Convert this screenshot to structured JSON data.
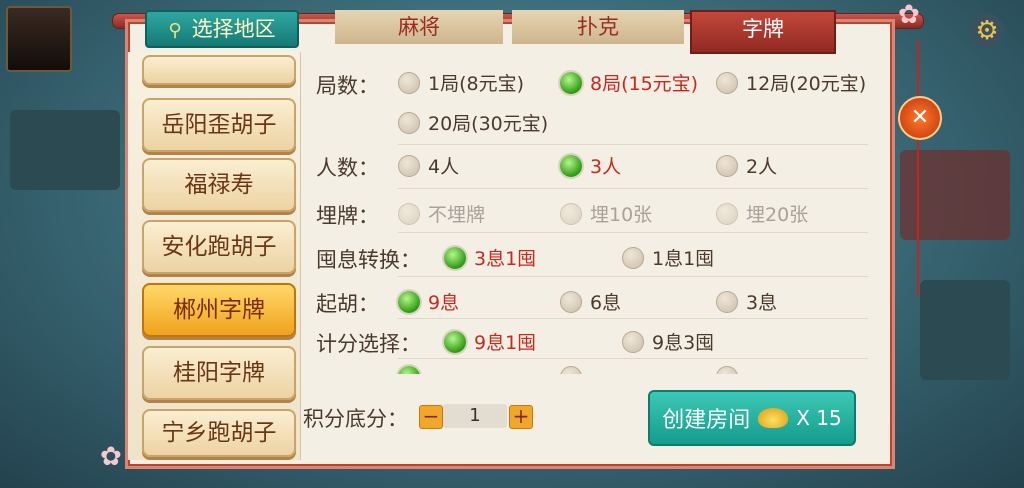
{
  "tabs": {
    "region": "选择地区",
    "mahjong": "麻将",
    "poker": "扑克",
    "zipai": "字牌"
  },
  "regions": [
    {
      "label": "岳阳歪胡子",
      "active": false
    },
    {
      "label": "福禄寿",
      "active": false
    },
    {
      "label": "安化跑胡子",
      "active": false
    },
    {
      "label": "郴州字牌",
      "active": true
    },
    {
      "label": "桂阳字牌",
      "active": false
    },
    {
      "label": "宁乡跑胡子",
      "active": false
    }
  ],
  "options": {
    "rounds": {
      "label": "局数：",
      "choices": [
        "1局(8元宝)",
        "8局(15元宝)",
        "12局(20元宝)",
        "20局(30元宝)"
      ],
      "selected": 1
    },
    "players": {
      "label": "人数：",
      "choices": [
        "4人",
        "3人",
        "2人"
      ],
      "selected": 1
    },
    "bury": {
      "label": "埋牌：",
      "choices": [
        "不埋牌",
        "埋10张",
        "埋20张"
      ],
      "disabled": true
    },
    "conversion": {
      "label": "囤息转换：",
      "choices": [
        "3息1囤",
        "1息1囤"
      ],
      "selected": 0
    },
    "qihu": {
      "label": "起胡：",
      "choices": [
        "9息",
        "6息",
        "3息"
      ],
      "selected": 0
    },
    "scoring": {
      "label": "计分选择：",
      "choices": [
        "9息1囤",
        "9息3囤"
      ],
      "selected": 0
    }
  },
  "score": {
    "label": "积分底分：",
    "value": "1",
    "minus": "−",
    "plus": "+"
  },
  "create": {
    "label": "创建房间",
    "cost": "X 15"
  },
  "close": "✕",
  "icons": {
    "pin": "📍",
    "gear": "⚙"
  }
}
